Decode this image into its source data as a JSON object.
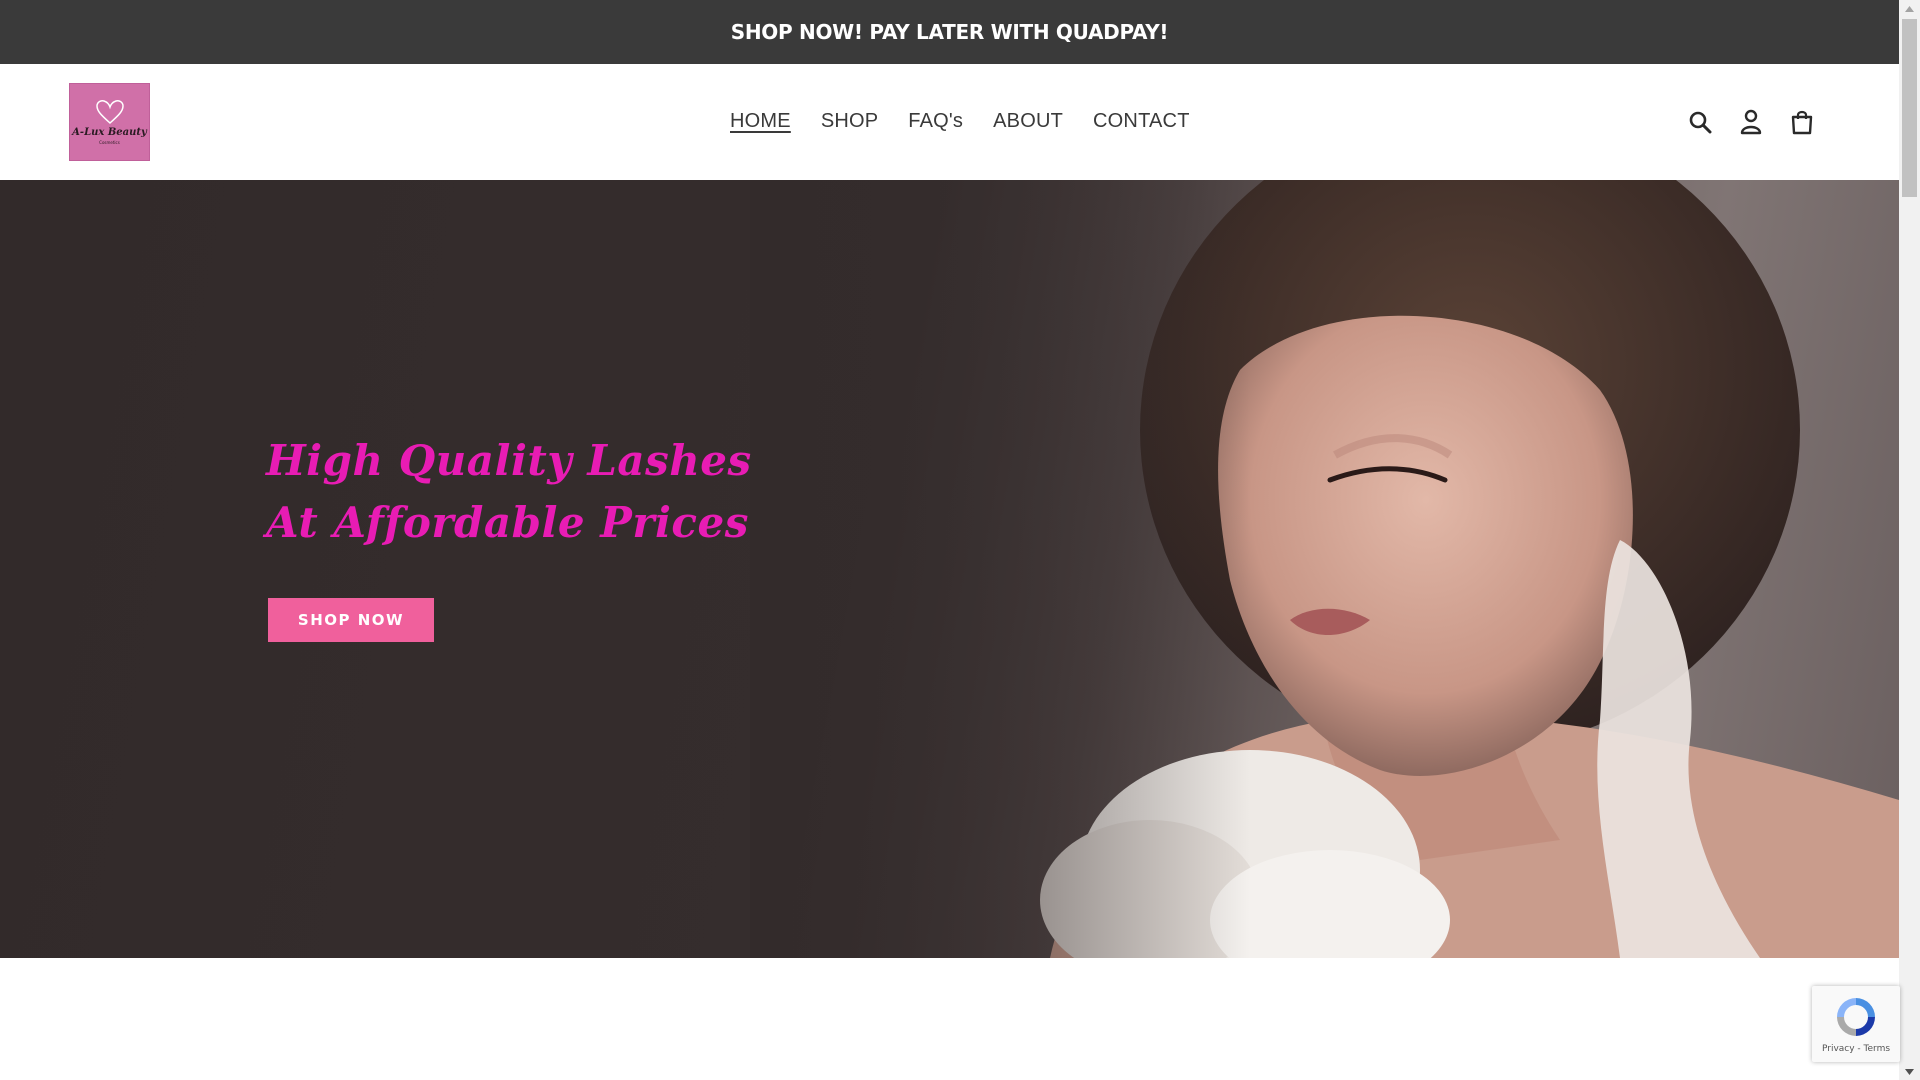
{
  "announcement": {
    "text": "SHOP NOW! PAY LATER WITH QUADPAY!"
  },
  "brand": {
    "logo_name": "A-Lux Beauty",
    "logo_sub": "Cosmetics",
    "logo_bg": "#d070a8"
  },
  "nav": {
    "items": [
      {
        "label": "HOME",
        "active": true
      },
      {
        "label": "SHOP",
        "active": false
      },
      {
        "label": "FAQ's",
        "active": false
      },
      {
        "label": "ABOUT",
        "active": false
      },
      {
        "label": "CONTACT",
        "active": false
      }
    ]
  },
  "header_icons": [
    "search-icon",
    "account-icon",
    "cart-icon"
  ],
  "hero": {
    "heading_line_1": "High Quality Lashes",
    "heading_line_2": "At Affordable Prices",
    "button_label": "SHOP NOW",
    "heading_color": "#e81cb4",
    "button_color": "#f0609c"
  },
  "recaptcha": {
    "links": "Privacy - Terms"
  },
  "colors": {
    "announcement_bg": "#3a3a3a",
    "hero_bg": "#332b2b"
  }
}
